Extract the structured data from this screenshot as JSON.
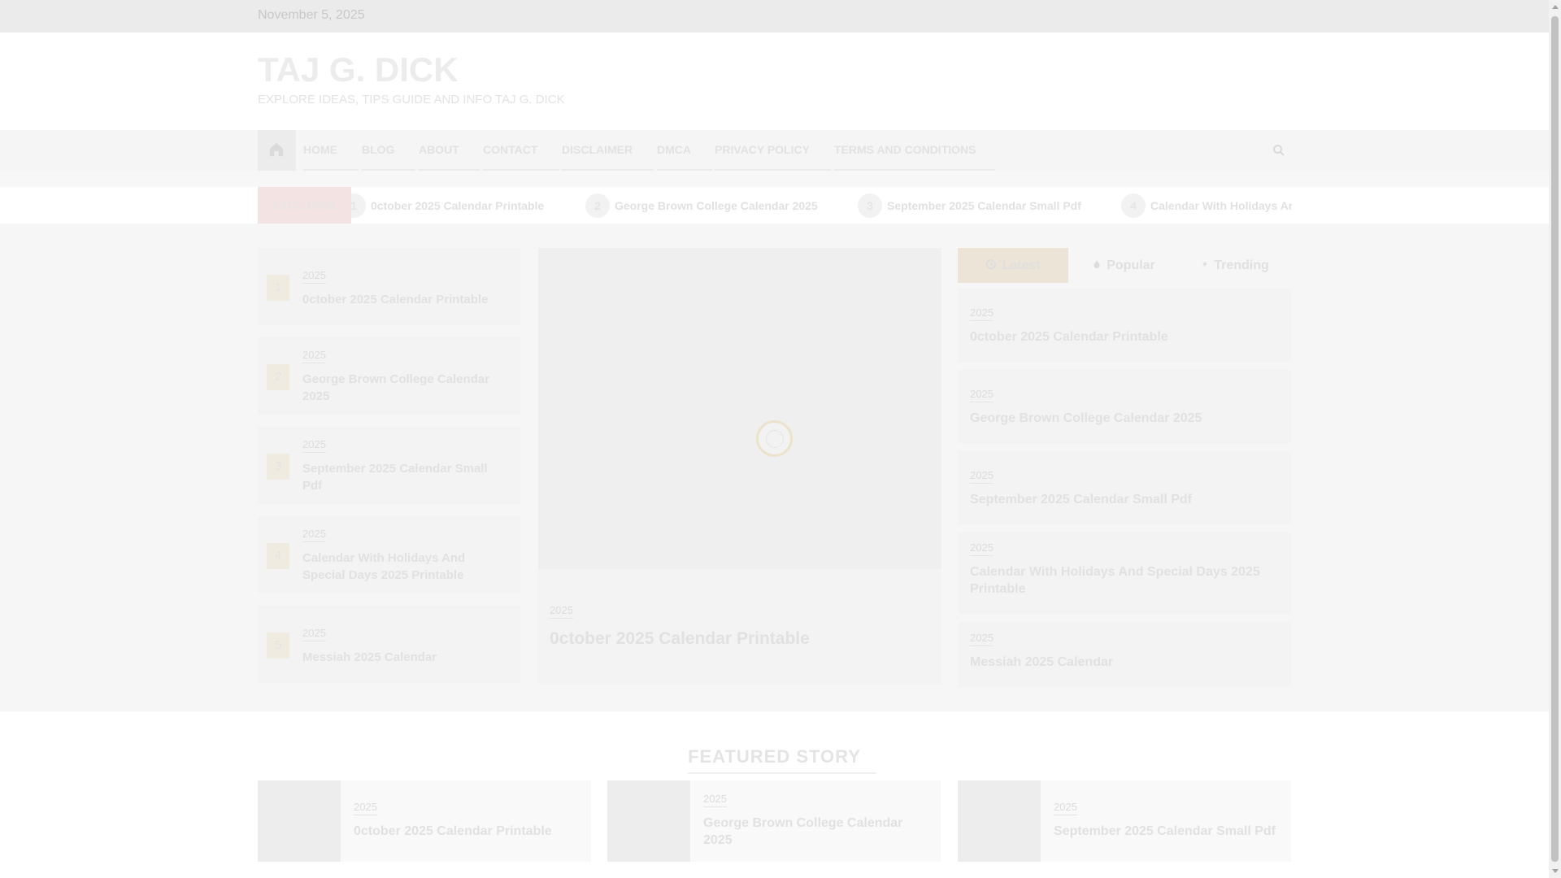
{
  "top_bar": {
    "date": "November 5, 2025"
  },
  "site": {
    "title": "TAJ G. DICK",
    "tagline": "EXPLORE IDEAS, TIPS GUIDE AND INFO TAJ G. DICK"
  },
  "nav": {
    "items": [
      "HOME",
      "BLOG",
      "ABOUT",
      "CONTACT",
      "DISCLAIMER",
      "DMCA",
      "PRIVACY POLICY",
      "TERMS AND CONDITIONS"
    ]
  },
  "ticker": {
    "label": "EXCLUSIVE",
    "items": [
      {
        "num": "1",
        "title": "0ctober 2025 Calendar Printable"
      },
      {
        "num": "2",
        "title": "George Brown College Calendar 2025"
      },
      {
        "num": "3",
        "title": "September 2025 Calendar Small Pdf"
      },
      {
        "num": "4",
        "title": "Calendar With Holidays Ar"
      }
    ]
  },
  "left_list": [
    {
      "rank": "1",
      "category": "2025",
      "title": "0ctober 2025 Calendar Printable"
    },
    {
      "rank": "2",
      "category": "2025",
      "title": "George Brown College Calendar 2025"
    },
    {
      "rank": "3",
      "category": "2025",
      "title": "September 2025 Calendar Small Pdf"
    },
    {
      "rank": "4",
      "category": "2025",
      "title": "Calendar With Holidays And Special Days 2025 Printable"
    },
    {
      "rank": "5",
      "category": "2025",
      "title": "Messiah 2025 Calendar"
    }
  ],
  "main_post": {
    "category": "2025",
    "title": "0ctober 2025 Calendar Printable"
  },
  "tabs": {
    "latest": "Latest",
    "popular": "Popular",
    "trending": "Trending"
  },
  "right_list": [
    {
      "category": "2025",
      "title": "0ctober 2025 Calendar Printable"
    },
    {
      "category": "2025",
      "title": "George Brown College Calendar 2025"
    },
    {
      "category": "2025",
      "title": "September 2025 Calendar Small Pdf"
    },
    {
      "category": "2025",
      "title": "Calendar With Holidays And Special Days 2025 Printable"
    },
    {
      "category": "2025",
      "title": "Messiah 2025 Calendar"
    }
  ],
  "featured": {
    "heading": "FEATURED STORY",
    "items": [
      {
        "category": "2025",
        "title": "0ctober 2025 Calendar Printable"
      },
      {
        "category": "2025",
        "title": "George Brown College Calendar 2025"
      },
      {
        "category": "2025",
        "title": "September 2025 Calendar Small Pdf"
      }
    ]
  }
}
